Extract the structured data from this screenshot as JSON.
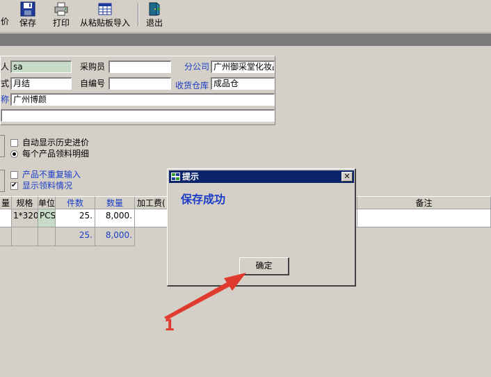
{
  "toolbar": {
    "items": [
      {
        "label": "价",
        "icon": "price-icon"
      },
      {
        "label": "保存",
        "icon": "floppy-disk-icon"
      },
      {
        "label": "打印",
        "icon": "printer-icon"
      },
      {
        "label": "从粘贴板导入",
        "icon": "clipboard-grid-icon"
      },
      {
        "label": "退出",
        "icon": "exit-door-icon"
      }
    ]
  },
  "form": {
    "row1": {
      "label_left": "人",
      "value_left": "sa",
      "label_mid": "采购员",
      "value_mid": "",
      "label_right": "分公司",
      "value_right": "广州御采堂化妆品"
    },
    "row2": {
      "label_left": "式",
      "value_left": "月结",
      "label_mid": "自编号",
      "value_mid": "",
      "label_right": "收货仓库",
      "value_right": "成品仓"
    },
    "row3": {
      "label_left": "称",
      "value_left": "广州博颜"
    },
    "row4": {
      "value": ""
    }
  },
  "options": {
    "auto_history_price": {
      "label": "自动显示历史进价",
      "checked": false
    },
    "each_product_detail": {
      "label": "每个产品领料明细",
      "checked": true
    },
    "no_duplicate_input": {
      "label": "产品不重复输入",
      "checked": false
    },
    "show_material": {
      "label": "显示领料情况",
      "checked": true
    }
  },
  "grid": {
    "headers": [
      "量",
      "规格",
      "单位",
      "件数",
      "数量",
      "加工费(",
      "备注"
    ],
    "row": [
      "",
      "1*320",
      "PCS",
      "25.",
      "8,000.",
      "",
      ""
    ],
    "summary": {
      "pieces": "25.",
      "quantity": "8,000."
    }
  },
  "dialog": {
    "title": "提示",
    "close": "✕",
    "message": "保存成功",
    "ok_label": "确定"
  },
  "annotation": {
    "number": "1",
    "color": "#e03a2f"
  },
  "colors": {
    "titlebar": "#0a246a",
    "blue_text": "#1a3cc8",
    "field_green": "#c6dcc6",
    "window_bg": "#d4d0c8"
  }
}
